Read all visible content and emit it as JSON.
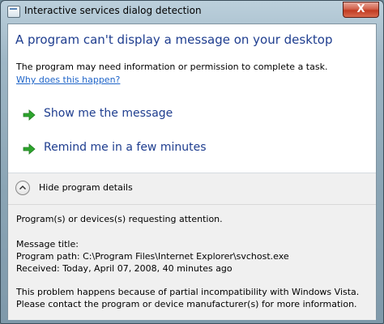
{
  "window": {
    "title": "Interactive services dialog detection",
    "close_label": "X"
  },
  "main": {
    "heading": "A program can't display a message on your desktop",
    "description": "The program may need information or permission to complete a task.",
    "why_link": "Why does this happen?"
  },
  "commands": [
    {
      "label": "Show me the message",
      "icon": "green-arrow-icon"
    },
    {
      "label": "Remind me in a few minutes",
      "icon": "green-arrow-icon"
    }
  ],
  "details": {
    "toggle_label": "Hide program details",
    "toggle_icon": "chevron-up-icon",
    "requesting": "Program(s) or devices(s) requesting attention.",
    "message_title": "Message title:",
    "program_path": "Program path:  C:\\Program Files\\Internet Explorer\\svchost.exe",
    "received": "Received:  Today, April 07, 2008, 40 minutes ago",
    "problem_line1": "This problem happens because of partial incompatibility with Windows Vista.",
    "problem_line2": "Please contact the program or device manufacturer(s) for more information."
  },
  "colors": {
    "heading": "#1e3d8f",
    "link": "#1e64c8",
    "arrow": "#2da52d",
    "close_button": "#c13b22"
  }
}
